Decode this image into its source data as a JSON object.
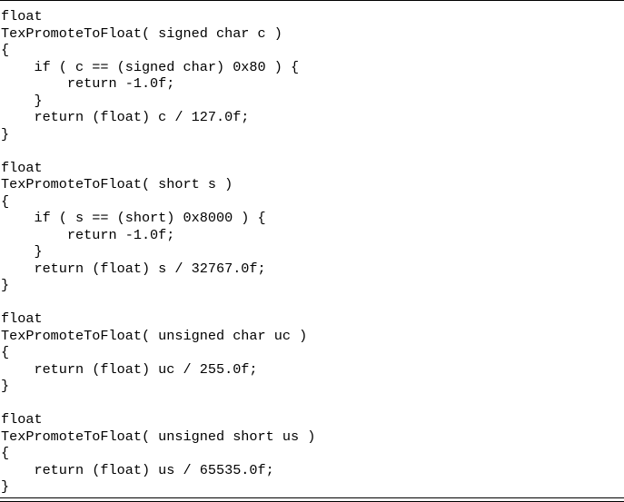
{
  "document": {
    "code_lines": [
      "float",
      "TexPromoteToFloat( signed char c )",
      "{",
      "    if ( c == (signed char) 0x80 ) {",
      "        return -1.0f;",
      "    }",
      "    return (float) c / 127.0f;",
      "}",
      "",
      "float",
      "TexPromoteToFloat( short s )",
      "{",
      "    if ( s == (short) 0x8000 ) {",
      "        return -1.0f;",
      "    }",
      "    return (float) s / 32767.0f;",
      "}",
      "",
      "float",
      "TexPromoteToFloat( unsigned char uc )",
      "{",
      "    return (float) uc / 255.0f;",
      "}",
      "",
      "float",
      "TexPromoteToFloat( unsigned short us )",
      "{",
      "    return (float) us / 65535.0f;",
      "}"
    ]
  }
}
